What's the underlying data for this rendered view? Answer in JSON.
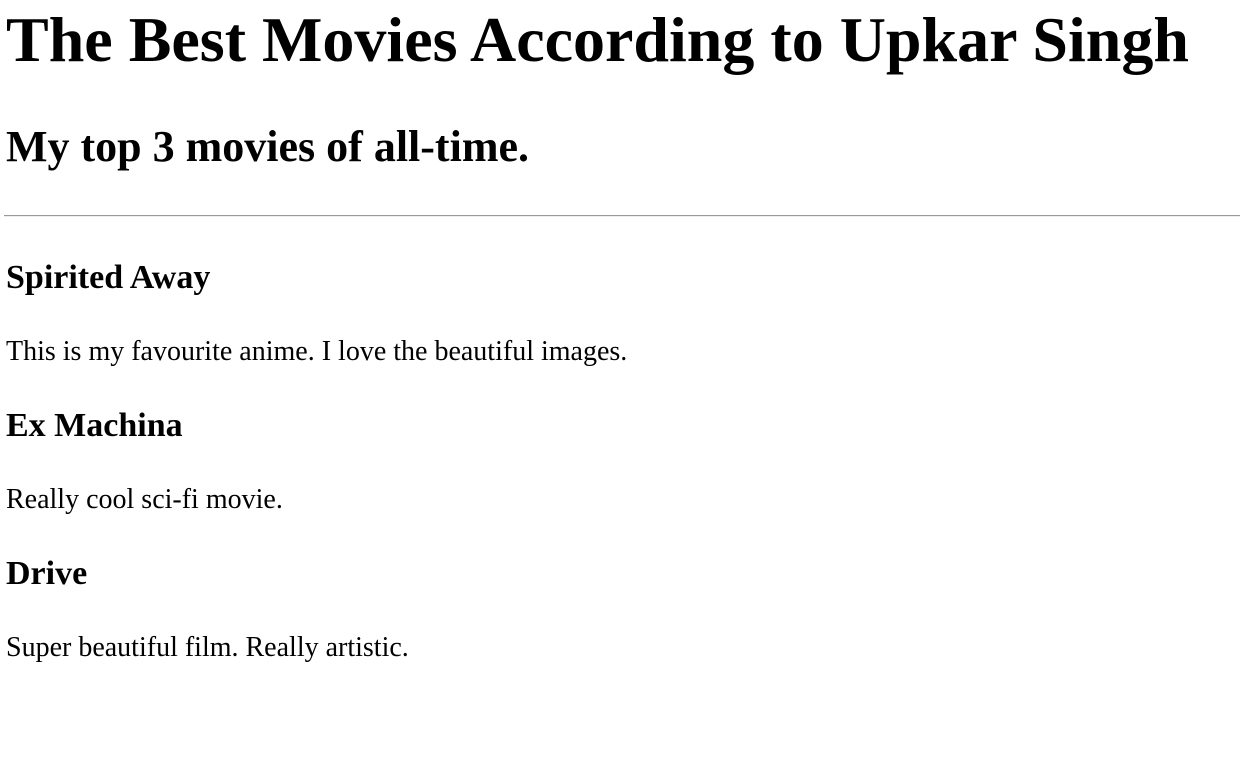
{
  "page": {
    "title": "The Best Movies According to Upkar Singh",
    "subtitle": "My top 3 movies of all-time."
  },
  "movies": [
    {
      "title": "Spirited Away",
      "description": "This is my favourite anime. I love the beautiful images."
    },
    {
      "title": "Ex Machina",
      "description": "Really cool sci-fi movie."
    },
    {
      "title": "Drive",
      "description": "Super beautiful film. Really artistic."
    }
  ]
}
